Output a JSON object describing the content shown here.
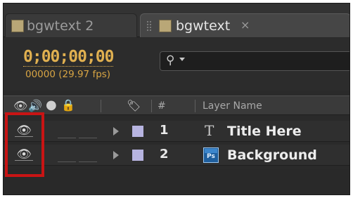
{
  "tabs": [
    {
      "label": "bgwtext 2",
      "active": false
    },
    {
      "label": "bgwtext",
      "active": true,
      "close": "×"
    }
  ],
  "timecode": {
    "value": "0;00;00;00",
    "fps": "00000 (29.97 fps)"
  },
  "search": {
    "icon": "search-icon"
  },
  "columns": {
    "number": "#",
    "layer_name": "Layer Name"
  },
  "layers": [
    {
      "number": "1",
      "name": "Title Here",
      "type_icon": "text-layer-icon",
      "type_glyph": "T",
      "label_color": "#b7b4e0",
      "visible": true
    },
    {
      "number": "2",
      "name": "Background",
      "type_icon": "photoshop-layer-icon",
      "type_glyph": "Ps",
      "label_color": "#b7b4e0",
      "visible": true
    }
  ],
  "colors": {
    "timecode": "#e0b050",
    "highlight": "#c91414",
    "tab_swatch": "#b9a777"
  }
}
